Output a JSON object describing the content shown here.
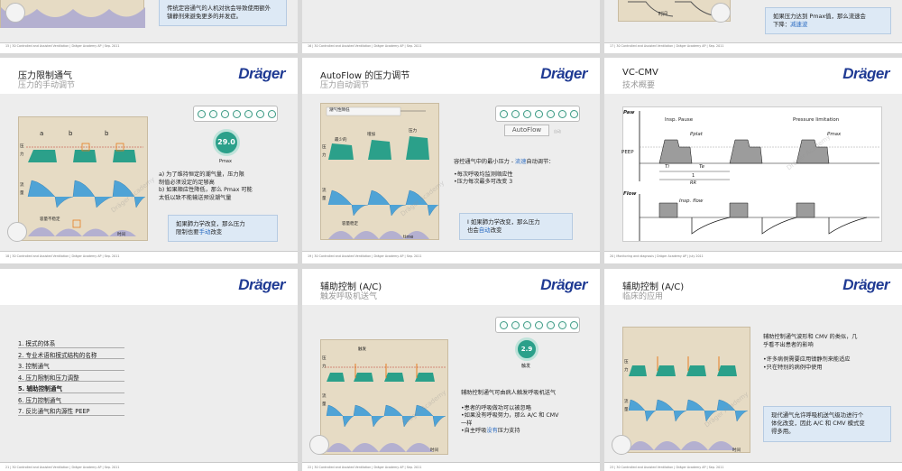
{
  "top_row": {
    "s15_text_line1": "传统定容通气的人机对抗会导致使用额外",
    "s15_text_line2": "镇静剂来避免更多的并发症。",
    "s17_text_line1": "如果压力达到",
    "s17_text_p": "Pmax",
    "s17_text_line1b": "值，那么流速会",
    "s17_text_line2a": "下降：",
    "s17_text_hl": "减速波",
    "s17_axis": "时间"
  },
  "footers": {
    "f15": "15 | 30    Controlled and Assisted Ventilation  |  Dräger Academy AP  |  Sep. 2011",
    "f16_top": "16 | 30    Controlled and Assisted Ventilation  |  Dräger Academy AP  |  Sep. 2011",
    "f17": "17 | 30    Controlled and Assisted Ventilation  |  Dräger Academy AP  |  Sep. 2011",
    "f18": "18 | 30    Controlled and Assisted Ventilation  |  Dräger Academy AP  |  Sep. 2011",
    "f19": "19 | 30    Controlled and Assisted Ventilation  |  Dräger Academy AP  |  Sep. 2011",
    "f20": "20 |    Monitoring and diagnosis  |  Dräger Academy AP  |  July 2011",
    "f21": "21 | 30    Controlled and Assisted Ventilation  |  Dräger Academy AP  |  Sep. 2011",
    "f22": "22 | 30    Controlled and Assisted Ventilation  |  Dräger Academy AP  |  Sep. 2011",
    "f23": "23 | 30    Controlled and Assisted Ventilation  |  Dräger Academy AP  |  Sep. 2011"
  },
  "logo": "Dräger",
  "s18": {
    "title": "压力限制通气",
    "subtitle": "压力的手动调节",
    "knob_value": "29.0",
    "knob_label": "Pmax",
    "label_a": "a",
    "label_b1": "b",
    "label_b2": "b",
    "y1": "压力",
    "y2": "流量",
    "plateau": "容量不稳定",
    "axis": "时间",
    "item_a_l1": "a)  为了维持恒定的潮气量，压力限",
    "item_a_l2": "     制值必须设定的足够高",
    "item_b_l1": "b)  如果顺应性降低，那么 Pmax 可能",
    "item_b_l2": "     太低以致不能输送预设潮气量",
    "box_l1": "如果肺力学改变，那么压力",
    "box_l2a": "限制也要",
    "box_hl": "手动",
    "box_l2b": "改变"
  },
  "s19": {
    "title": "AutoFlow 的压力调节",
    "subtitle": "压力自动调节",
    "autoflow_label": "AutoFlow",
    "autoflow_small": "自动",
    "chart_hdr": "潮气性降低",
    "l_min": "最少的",
    "l_inc": "增加",
    "l_p": "压力",
    "l_vol": "容量稳定",
    "axis": "time",
    "y1": "压力",
    "y2": "流量",
    "line1a": "容控通气中的最小压力 - ",
    "line1hl": "流速",
    "line1b": "自动调节：",
    "b1": "•每次呼吸均监测顺应性",
    "b2": "•压力每次最多可改变 3",
    "box_l1": "I 如果肺力学改变，那么压力",
    "box_l2a": "也会",
    "box_hl": "自动",
    "box_l2b": "改变"
  },
  "s20": {
    "title": "VC-CMV",
    "subtitle": "技术概要",
    "paw": "Paw",
    "insp_pause": "Insp. Pause",
    "pplat": "Pplat",
    "plimit": "Pressure limitation",
    "pmax": "Pmax",
    "peep": "PEEP",
    "ti": "Ti",
    "te": "Te",
    "one": "1",
    "rr": "RR",
    "flow": "Flow",
    "insp_flow": "Insp. flow"
  },
  "s21": {
    "toc": [
      "1. 模式的体系",
      "2. 专业术语和模式结构的名称",
      "3. 控制通气",
      "4. 压力限制和压力调整",
      "5. 辅助控制通气",
      "6. 压力控制通气",
      "7. 反比通气和内源性 PEEP"
    ],
    "active_index": 4
  },
  "s22": {
    "title": "辅助控制 (A/C)",
    "subtitle": "触发呼吸机送气",
    "knob_value": "2.9",
    "knob_label": "触发",
    "trig": "触发",
    "y1": "压力",
    "y2": "流量",
    "axis": "时间",
    "head": "辅助控制通气可由病人触发呼吸机送气",
    "b1": "•患者的呼吸做功可以被忽略",
    "b2": "•如果没有呼吸努力，那么 A/C 和 CMV",
    "b2b": "  一样",
    "b3a": "•自主呼吸",
    "b3hl": "没有",
    "b3b": "压力支持"
  },
  "s23": {
    "title": "辅助控制 (A/C)",
    "subtitle": "临床的应用",
    "y1": "压力",
    "y2": "流量",
    "axis": "时间",
    "p1": "辅助控制通气波形和 CMV 的类似，几",
    "p1b": "乎看不出患者的影响",
    "b1": "•许多病例需要应用镇静剂来能适应",
    "b2": "•只在特别的病例中使用",
    "box_l1": "现代通气允许呼吸机送气级功进行个",
    "box_l2": "体化改变，因此 A/C 和 CMV 模式变",
    "box_l3": "得多用。"
  },
  "watermark": "Dräger Academy"
}
